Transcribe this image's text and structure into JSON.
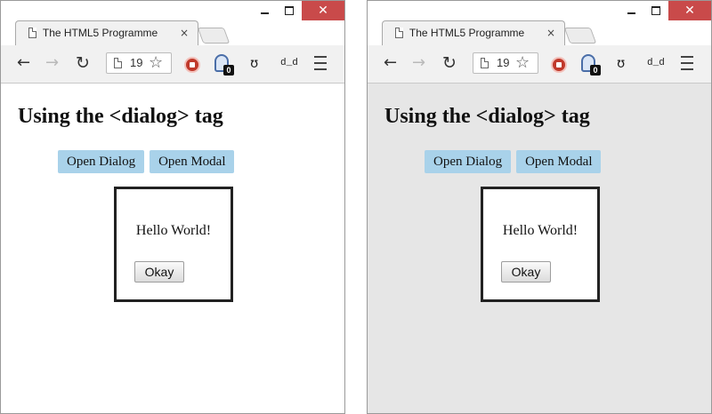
{
  "windows": [
    {
      "tab_title": "The HTML5 Programme",
      "address_text": "19",
      "ext_badge": "0",
      "ext_label": "d_d",
      "heading": "Using the <dialog> tag",
      "buttons": {
        "open_dialog": "Open Dialog",
        "open_modal": "Open Modal"
      },
      "dialog": {
        "message": "Hello World!",
        "okay_label": "Okay"
      },
      "modal_backdrop": false
    },
    {
      "tab_title": "The HTML5 Programme",
      "address_text": "19",
      "ext_badge": "0",
      "ext_label": "d_d",
      "heading": "Using the <dialog> tag",
      "buttons": {
        "open_dialog": "Open Dialog",
        "open_modal": "Open Modal"
      },
      "dialog": {
        "message": "Hello World!",
        "okay_label": "Okay"
      },
      "modal_backdrop": true
    }
  ],
  "icons": {
    "close_glyph": "✕",
    "tab_close_glyph": "×",
    "back_glyph": "←",
    "forward_glyph": "→",
    "reload_glyph": "↻",
    "star_glyph": "☆",
    "face_glyph": "ʊ"
  },
  "colors": {
    "close_button": "#c94a4a",
    "page_button": "#a9d2ea",
    "modal_backdrop": "#e6e6e6"
  }
}
